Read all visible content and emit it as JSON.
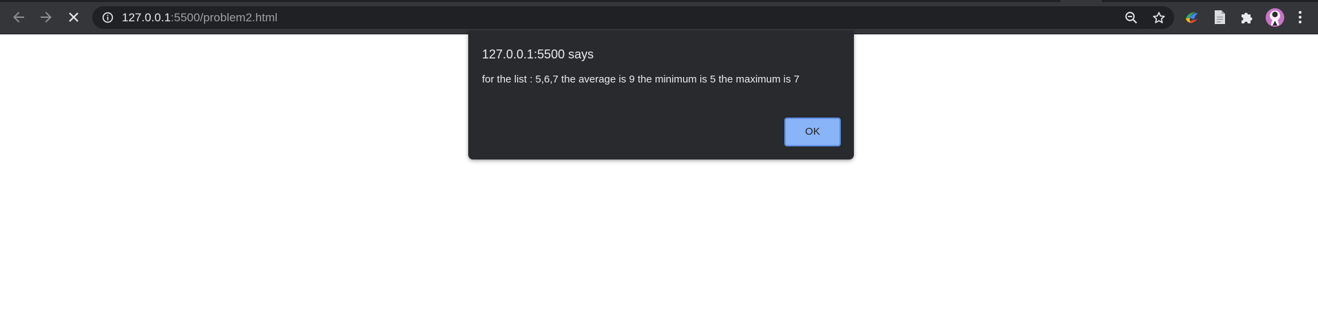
{
  "browser": {
    "url_host": "127.0.0.1",
    "url_rest": ":5500/problem2.html",
    "icons": {
      "back": "arrow-left-icon",
      "forward": "arrow-right-icon",
      "stop": "close-icon",
      "site_info": "info-icon",
      "zoom": "zoom-out-icon",
      "bookmark": "star-icon",
      "extension_1": "extension-app-icon",
      "extension_2": "document-icon",
      "extensions": "puzzle-icon",
      "menu": "more-vert-icon"
    }
  },
  "dialog": {
    "title": "127.0.0.1:5500 says",
    "message": "for the list : 5,6,7 the average is 9 the minimum is 5 the maximum is 7",
    "ok_label": "OK"
  },
  "colors": {
    "toolbar": "#35363a",
    "omnibox": "#202124",
    "dialog": "#292a2d",
    "accent": "#8ab4f8"
  }
}
